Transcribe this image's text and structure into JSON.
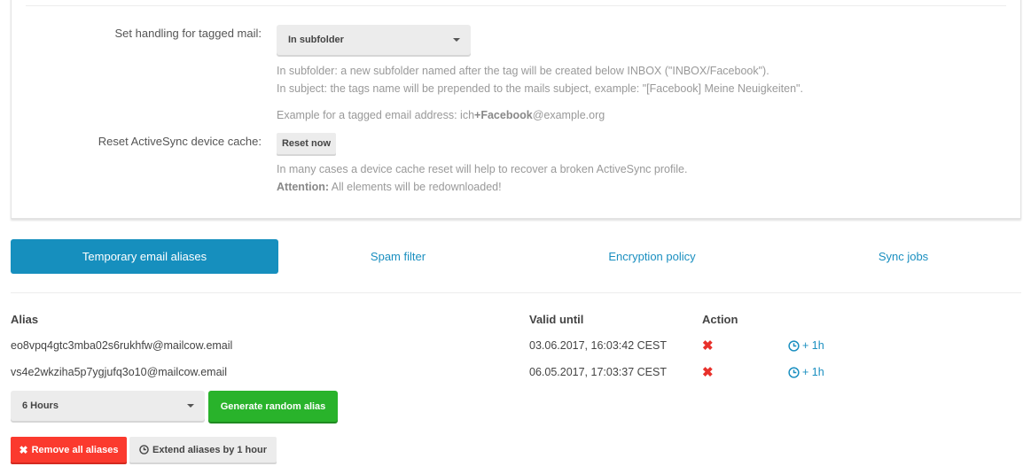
{
  "settings": {
    "tagged_mail": {
      "label": "Set handling for tagged mail:",
      "select_value": "In subfolder",
      "help_line1": "In subfolder: a new subfolder named after the tag will be created below INBOX (\"INBOX/Facebook\").",
      "help_line2": "In subject: the tags name will be prepended to the mails subject, example: \"[Facebook] Meine Neuigkeiten\".",
      "example_prefix": "Example for a tagged email address: ich",
      "example_bold": "+Facebook",
      "example_suffix": "@example.org"
    },
    "activesync": {
      "label": "Reset ActiveSync device cache:",
      "button_label": "Reset now",
      "help_line1": "In many cases a device cache reset will help to recover a broken ActiveSync profile.",
      "attention_bold": "Attention:",
      "attention_text": " All elements will be redownloaded!"
    }
  },
  "tabs": [
    {
      "label": "Temporary email aliases",
      "active": true
    },
    {
      "label": "Spam filter",
      "active": false
    },
    {
      "label": "Encryption policy",
      "active": false
    },
    {
      "label": "Sync jobs",
      "active": false
    }
  ],
  "aliases_table": {
    "headers": {
      "alias": "Alias",
      "valid_until": "Valid until",
      "action": "Action"
    },
    "rows": [
      {
        "alias": "eo8vpq4gtc3mba02s6rukhfw@mailcow.email",
        "valid_until": "03.06.2017, 16:03:42 CEST",
        "extend_label": "+ 1h"
      },
      {
        "alias": "vs4e2wkziha5p7ygjufq3o10@mailcow.email",
        "valid_until": "06.05.2017, 17:03:37 CEST",
        "extend_label": "+ 1h"
      }
    ]
  },
  "controls": {
    "duration_select_value": "6 Hours",
    "generate_button": "Generate random alias",
    "remove_all_button": "Remove all aliases",
    "extend_all_button": "Extend aliases by 1 hour"
  },
  "colors": {
    "primary": "#168fbe",
    "success": "#29b32b",
    "danger": "#fb3a2e",
    "link": "#1a8fc0"
  }
}
